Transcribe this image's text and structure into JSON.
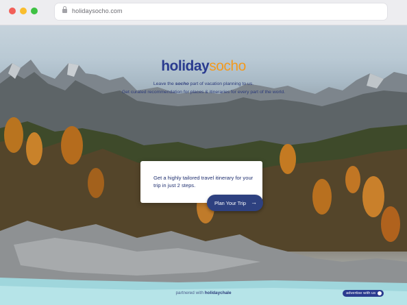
{
  "browser": {
    "url": "holidaysocho.com"
  },
  "logo": {
    "part1": "holiday",
    "part2": "socho"
  },
  "tagline": {
    "line1_before": "Leave the ",
    "line1_em": "socho",
    "line1_after": " part of vacation planning to us.",
    "line2": "Get curated recommendation for places & itineraries for every part of the world."
  },
  "card": {
    "text": "Get a highly tailored travel itinerary for your trip in just 2 steps."
  },
  "cta": {
    "label": "Plan Your Trip",
    "arrow": "→"
  },
  "footer": {
    "prefix": "partnered with ",
    "partner": "holidaychale",
    "advertise_label": "advertise with us"
  }
}
